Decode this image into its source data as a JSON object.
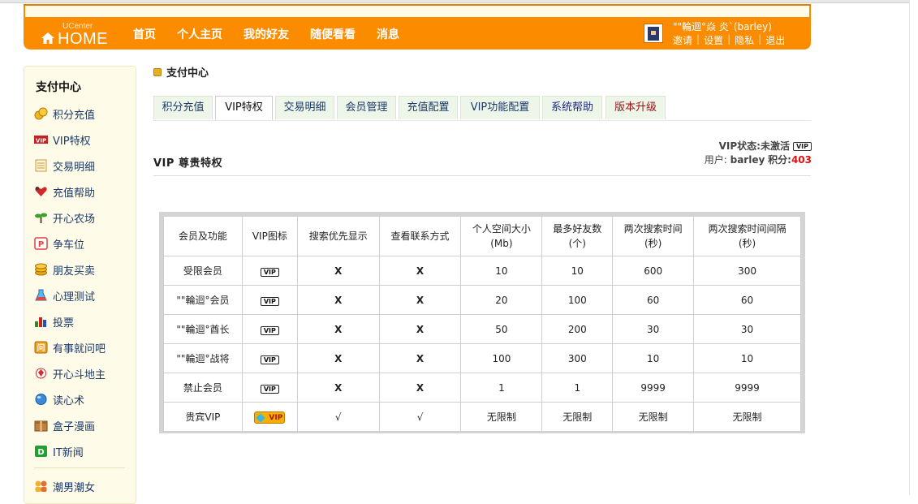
{
  "header": {
    "logo_small": "UCenter",
    "logo_big": "HOME",
    "nav": [
      "首页",
      "个人主页",
      "我的好友",
      "随便看看",
      "消息"
    ],
    "username": "\"\"輪迴°焱 炎`(barley)",
    "user_links": [
      "邀请",
      "设置",
      "隐私",
      "退出"
    ]
  },
  "sidebar": {
    "title": "支付中心",
    "items": [
      {
        "label": "积分充值",
        "icon": "coins-icon"
      },
      {
        "label": "VIP特权",
        "icon": "vip-icon"
      },
      {
        "label": "交易明细",
        "icon": "ledger-icon"
      },
      {
        "label": "充值帮助",
        "icon": "heart-icon"
      },
      {
        "label": "开心农场",
        "icon": "sprout-icon"
      },
      {
        "label": "争车位",
        "icon": "parking-icon"
      },
      {
        "label": "朋友买卖",
        "icon": "coin-stack-icon"
      },
      {
        "label": "心理测试",
        "icon": "flask-icon"
      },
      {
        "label": "投票",
        "icon": "bar-chart-icon"
      },
      {
        "label": "有事就问吧",
        "icon": "question-icon"
      },
      {
        "label": "开心斗地主",
        "icon": "cards-icon"
      },
      {
        "label": "读心术",
        "icon": "crystal-ball-icon"
      },
      {
        "label": "盒子漫画",
        "icon": "box-icon"
      },
      {
        "label": "IT新闻",
        "icon": "news-icon"
      }
    ],
    "extra_item": {
      "label": "潮男潮女",
      "icon": "people-icon"
    }
  },
  "main": {
    "page_title": "支付中心",
    "tabs": [
      "积分充值",
      "VIP特权",
      "交易明细",
      "会员管理",
      "充值配置",
      "VIP功能配置",
      "系统帮助",
      "版本升级"
    ],
    "active_tab": "VIP特权",
    "vip_status_label": "VIP状态:",
    "vip_status_value": "未激活",
    "user_label": "用户:",
    "user_value": "barley",
    "points_label": "积分:",
    "points_value": "403",
    "section_title": "VIP 尊贵特权",
    "vip_badge": "VIP"
  },
  "table": {
    "headers": [
      "会员及功能",
      "VIP图标",
      "搜索优先显示",
      "查看联系方式",
      "个人空间大小\n(Mb)",
      "最多好友数\n(个)",
      "两次搜索时间\n(秒)",
      "两次搜索时间间隔\n(秒)"
    ],
    "rows": [
      {
        "name": "受限会员",
        "icon": "VIP",
        "search": "X",
        "contact": "X",
        "space": "10",
        "friends": "10",
        "search_time": "600",
        "interval": "300"
      },
      {
        "name": "\"\"輪迴°会员",
        "icon": "VIP",
        "search": "X",
        "contact": "X",
        "space": "20",
        "friends": "100",
        "search_time": "60",
        "interval": "60"
      },
      {
        "name": "\"\"輪迴°酋长",
        "icon": "VIP",
        "search": "X",
        "contact": "X",
        "space": "50",
        "friends": "200",
        "search_time": "30",
        "interval": "30"
      },
      {
        "name": "\"\"輪迴°战将",
        "icon": "VIP",
        "search": "X",
        "contact": "X",
        "space": "100",
        "friends": "300",
        "search_time": "10",
        "interval": "10"
      },
      {
        "name": "禁止会员",
        "icon": "VIP",
        "search": "X",
        "contact": "X",
        "space": "1",
        "friends": "1",
        "search_time": "9999",
        "interval": "9999"
      },
      {
        "name": "贵宾VIP",
        "icon": "VIP",
        "search": "√",
        "contact": "√",
        "space": "无限制",
        "friends": "无限制",
        "search_time": "无限制",
        "interval": "无限制"
      }
    ]
  },
  "colors": {
    "header_orange": "#fb8c00",
    "sidebar_bg": "#fefbe8",
    "tab_bg": "#eef6ea",
    "points_red": "#e01010"
  }
}
